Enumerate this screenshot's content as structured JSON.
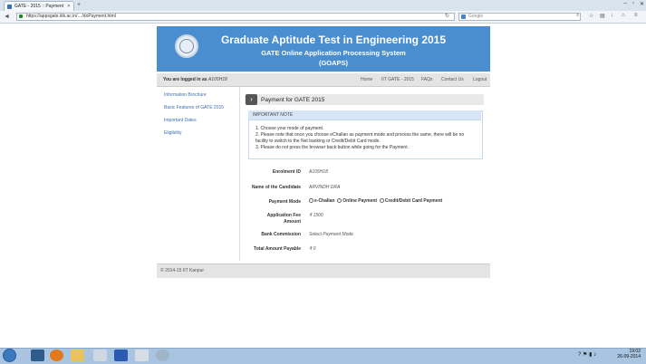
{
  "browser": {
    "tab_title": "GATE - 2015 :: Payment",
    "url": "https://appsgate.iitk.ac.in/…/doPayment.html",
    "search_placeholder": "Google"
  },
  "header": {
    "title": "Graduate Aptitude Test in Engineering 2015",
    "subtitle": "GATE Online Application Processing System",
    "abbr": "(GOAPS)"
  },
  "menubar": {
    "logged_in_prefix": "You are logged in as",
    "user_id": "A105H18",
    "nav": [
      "Home",
      "IIT GATE - 2015",
      "FAQs",
      "Contact Us",
      "Logout"
    ]
  },
  "sidebar": {
    "items": [
      "Information Brochure",
      "Basic Features of GATE 2015",
      "Important Dates",
      "Eligibility"
    ]
  },
  "main": {
    "page_title": "Payment for GATE 2015",
    "note_heading": "IMPORTANT NOTE",
    "note_lines": [
      "1.  Choose your mode of payment.",
      "2.  Please note that once you choose eChallan as payment mode and process the same, there will be no",
      "     facility to switch to the Net banking or Credit/Debit Card mode.",
      "3.  Please do not press the browser back button while going for the Payment."
    ],
    "fields": {
      "enrollment_label": "Enrolment ID",
      "enrollment_value": "A105H18",
      "name_label": "Name of the Candidate",
      "name_value": "ARVINDH DRA",
      "mode_label": "Payment Mode",
      "mode_options": [
        "e-Challan",
        "Online Payment",
        "Credit/Debit Card Payment"
      ],
      "fee_label_1": "Application Fee",
      "fee_label_2": "Amount",
      "fee_value": "₹ 1500",
      "bank_label": "Bank Commission",
      "bank_value": "Select Payment Mode",
      "total_label": "Total Amount Payable",
      "total_value": "₹ 0"
    }
  },
  "footer": {
    "text": "© 2014-15 IIT Kanpur"
  },
  "taskbar": {
    "time": "19:02",
    "date": "26-09-2014"
  }
}
